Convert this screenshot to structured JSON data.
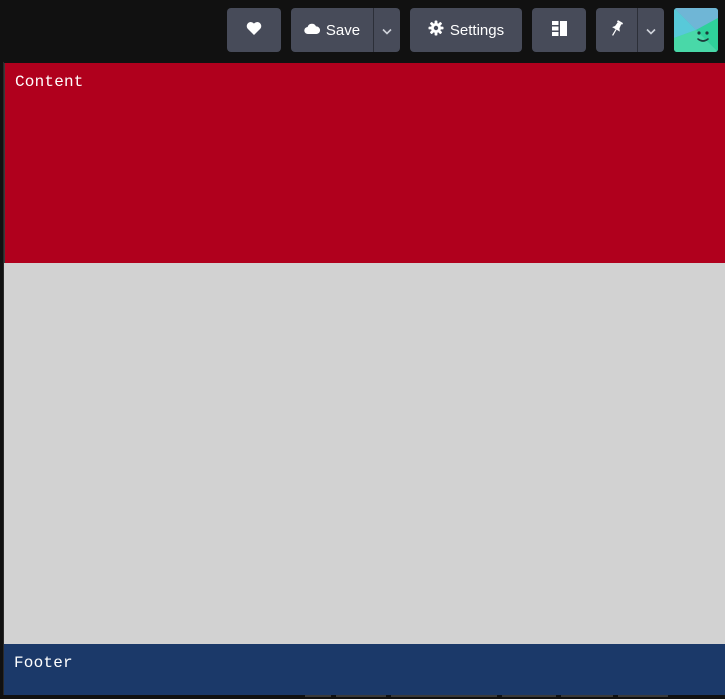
{
  "toolbar": {
    "favorite_icon": "heart-icon",
    "save_label": "Save",
    "save_icon": "cloud-icon",
    "save_dropdown_icon": "chevron-down-icon",
    "settings_label": "Settings",
    "settings_icon": "gear-icon",
    "layout_icon": "layout-icon",
    "pin_icon": "pin-icon",
    "pin_dropdown_icon": "chevron-down-icon",
    "button_color": "#474b59",
    "avatar_icon": "smiley-avatar"
  },
  "panels": {
    "content_label": "Content",
    "content_color": "#b0001d",
    "main_color": "#d2d2d2",
    "footer_label": "Footer",
    "footer_color": "#1b3969"
  }
}
